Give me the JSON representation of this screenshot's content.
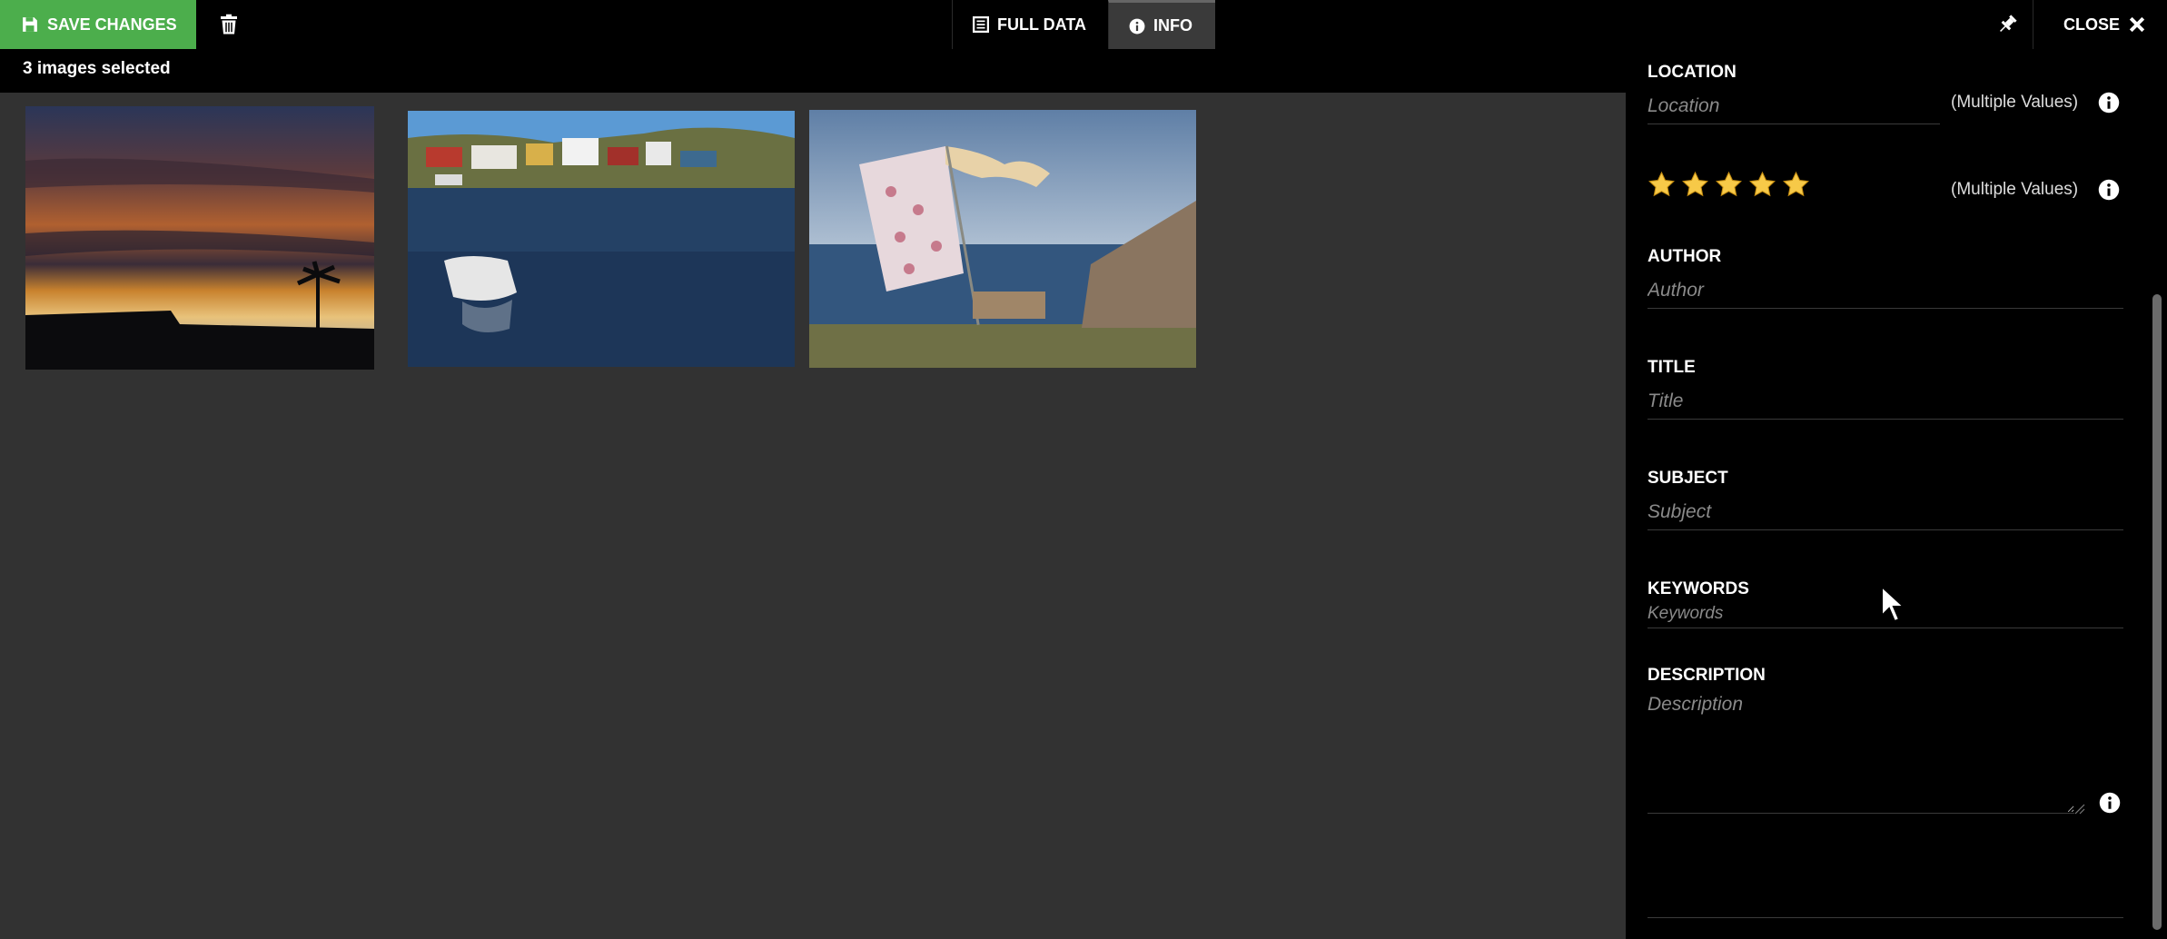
{
  "toolbar": {
    "save_label": "SAVE CHANGES",
    "save_icon": "floppy-icon",
    "delete_icon": "trash-icon",
    "tabs": [
      {
        "label": "FULL DATA",
        "icon": "list-icon",
        "active": false
      },
      {
        "label": "INFO",
        "icon": "info-icon",
        "active": true
      }
    ],
    "pin_icon": "pin-icon",
    "close_label": "CLOSE",
    "close_icon": "close-icon"
  },
  "selection": {
    "status": "3 images selected"
  },
  "images": [
    {
      "name": "sunset-palm"
    },
    {
      "name": "harbor-boats"
    },
    {
      "name": "flag-seaside"
    }
  ],
  "panel": {
    "location": {
      "label": "LOCATION",
      "placeholder": "Location",
      "multiple": "(Multiple Values)"
    },
    "rating": {
      "stars": 5,
      "multiple": "(Multiple Values)"
    },
    "author": {
      "label": "AUTHOR",
      "placeholder": "Author"
    },
    "title": {
      "label": "TITLE",
      "placeholder": "Title"
    },
    "subject": {
      "label": "SUBJECT",
      "placeholder": "Subject"
    },
    "keywords": {
      "label": "KEYWORDS",
      "placeholder": "Keywords"
    },
    "description": {
      "label": "DESCRIPTION",
      "placeholder": "Description"
    }
  },
  "colors": {
    "accent_green": "#4cae4c",
    "topbar": "#000000",
    "canvas": "#323232",
    "star": "#f7c948"
  }
}
